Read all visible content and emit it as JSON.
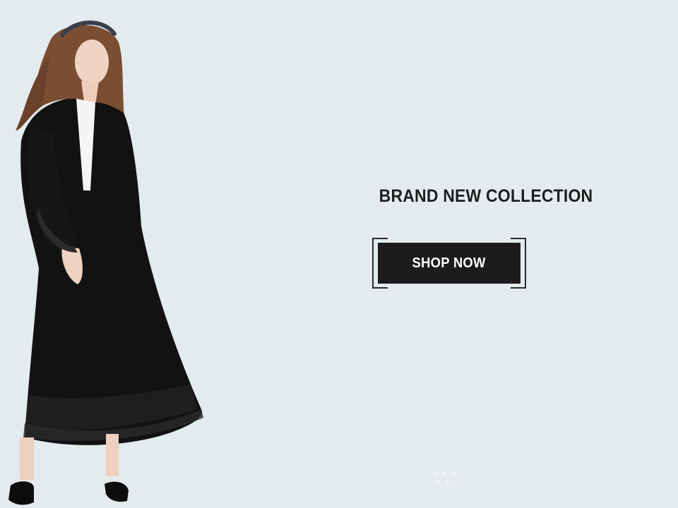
{
  "hero": {
    "headline": "BRAND NEW COLLECTION",
    "cta_label": "SHOP NOW"
  },
  "colors": {
    "background": "#e4ebee",
    "headline_text": "#1e1e1e",
    "button_bg": "#1d1b1c",
    "button_text": "#ffffff",
    "bracket": "#2a2a2a",
    "garment": "#111111"
  },
  "icons": {
    "pager": "slider-pagination-dots"
  }
}
